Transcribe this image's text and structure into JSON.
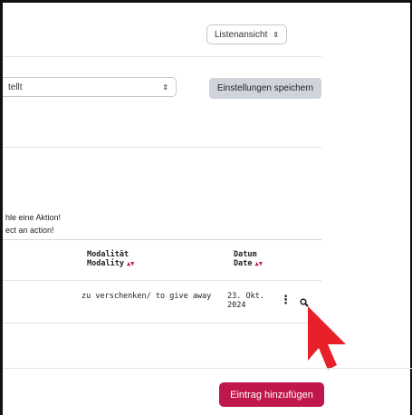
{
  "view_select": {
    "value": "Listenansicht"
  },
  "filter_select": {
    "value": "tellt"
  },
  "save_settings_button": {
    "label": "Einstellungen speichern"
  },
  "action_hint": {
    "line1": "hle eine Aktion!",
    "line2": "ect an action!"
  },
  "table": {
    "columns": [
      {
        "title_de": "Modalität",
        "title_en": "Modality",
        "sortable": true
      },
      {
        "title_de": "Datum",
        "title_en": "Date",
        "sortable": true
      }
    ],
    "rows": [
      {
        "modality": "zu verschenken/ to give away",
        "date_line1": "23. Okt.",
        "date_line2": "2024"
      }
    ],
    "sort_glyph": "▲▼"
  },
  "add_entry_button": {
    "label": "Eintrag hinzufügen"
  },
  "colors": {
    "accent": "#c0174b",
    "pointer": "#e8202a"
  },
  "icons": [
    "chevron-updown-icon",
    "kebab-menu-icon",
    "magnifier-icon",
    "pointer-arrow-icon"
  ]
}
